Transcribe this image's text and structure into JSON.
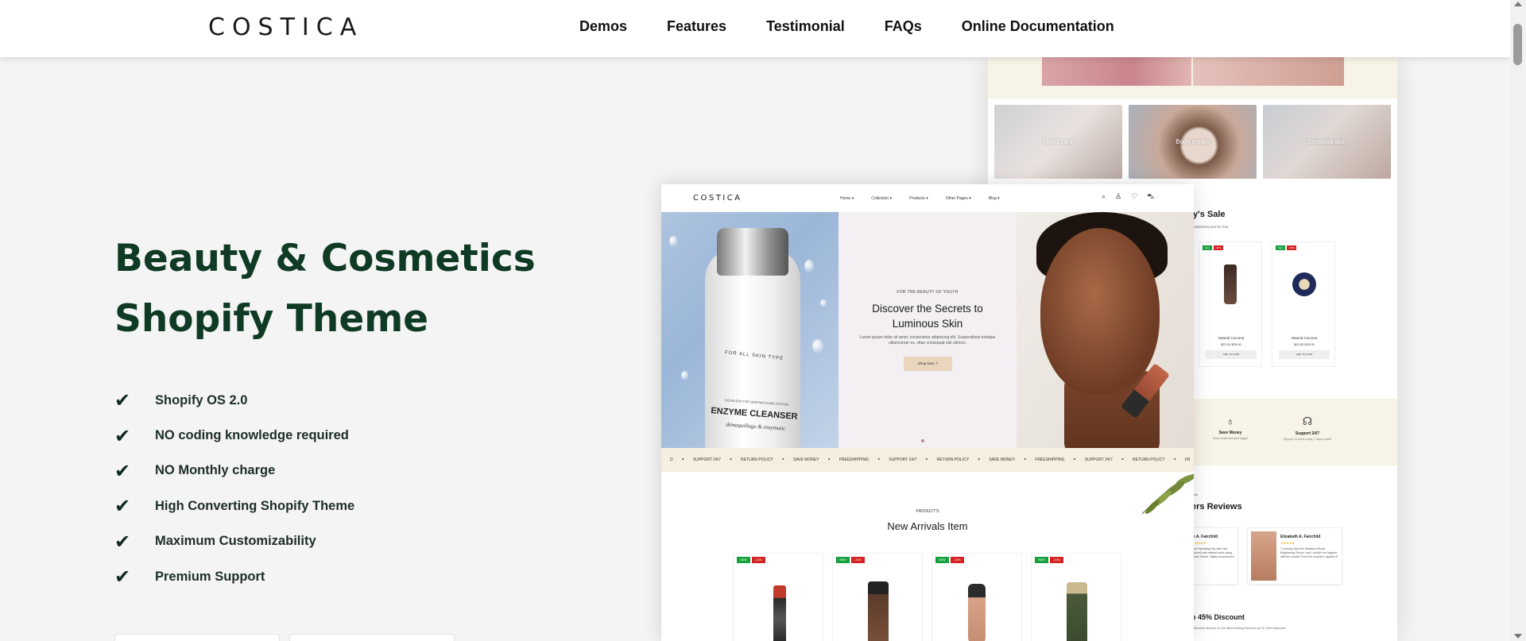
{
  "brand": "COSTICA",
  "nav": [
    "Demos",
    "Features",
    "Testimonial",
    "FAQs",
    "Online Documentation"
  ],
  "hero": {
    "title_line1": "Beauty & Cosmetics",
    "title_line2": "Shopify Theme",
    "features": [
      "Shopify OS 2.0",
      "NO coding knowledge required",
      "NO Monthly charge",
      "High Converting Shopify Theme",
      "Maximum Customizability",
      "Premium Support"
    ]
  },
  "colors": {
    "accent": "#0f3b25",
    "background": "#f4f4f4",
    "button": "#ead6bd",
    "badge_new": "#16a03c",
    "badge_off": "#d42222"
  },
  "icons": {
    "check": "check-icon",
    "search": "search-icon",
    "user": "user-icon",
    "wishlist": "heart-icon",
    "cart": "cart-icon"
  },
  "front_mockup": {
    "brand": "COSTICA",
    "nav": [
      "Home ▾",
      "Collection ▾",
      "Products ▾",
      "Other Pages ▾",
      "Blog ▾"
    ],
    "bottle": {
      "line1": "FOR ALL SKIN TYPE",
      "line0": "DOUBLEACTIVE DEEPMETHANE SYSTEM",
      "line2": "ENZYME CLEANSER",
      "line3": "démaquillage & enzymatic"
    },
    "kicker": "FOR THE BEAUTY OF YOUTH",
    "headline_line1": "Discover the Secrets to",
    "headline_line2": "Luminous Skin",
    "body": "Lorem ipsum dolor sit amet, consectetur adipiscing elit. Suspendisse tristique ullamcorper ex, vitae consequat nisl ultrices.",
    "button": "Shop Now ↗",
    "ticker": [
      "SUPPORT 24/7",
      "RETURN POLICY",
      "SAVE MONEY",
      "FREESHIPPING",
      "SUPPORT 24/7",
      "RETURN POLICY",
      "SAVE MONEY",
      "FREESHIPPING",
      "SUPPORT 24/7",
      "RETURN POLICY",
      "FR"
    ],
    "ticker_lead": "D",
    "arrivals_kicker": "PRODUCT'S",
    "arrivals_title": "New Arrivals Item",
    "badge_new": "NEW",
    "badge_off": "-20%"
  },
  "back_mockup": {
    "categories": [
      "Hand care",
      "Body cream",
      "Sensitive skin"
    ],
    "sale_heading": "y's Sale",
    "sale_sub": "reductions just for You",
    "cards": [
      {
        "tag1": "Sale",
        "tag2": "-20%",
        "name": "Natural Coconut",
        "price": "$22.00  $25.00",
        "button": "ADD TO CART"
      },
      {
        "tag1": "Sale",
        "tag2": "-20%",
        "name": "Natural Coconut",
        "price": "$22.00  $25.00",
        "button": "ADD TO CART"
      }
    ],
    "services": [
      {
        "title": "Save Money",
        "sub": "Shop smart and save bigger"
      },
      {
        "title": "Support 24/7",
        "sub": "Support 24 hours a day, 7 days a week"
      }
    ],
    "reviews_kicker": "nials",
    "reviews_heading": "ers Reviews",
    "review1_name": "th A. Fairchild",
    "review1_text": "rand Hydrating! My dark has reduced and radiant since using Facial Serum. Highly recommend.",
    "review2_name": "Elizabeth A. Fairchild",
    "review2_text": "\"I recently tried the Radiance Boost Brightening Serum, and I couldn't be happier with the results! From the moment I applied it\"",
    "stars": "★★★★★",
    "discount_heading": "o 45% Discount",
    "discount_sub": "s Receive Access to Our Best-Selling Nourish Up To 45% Discount"
  }
}
